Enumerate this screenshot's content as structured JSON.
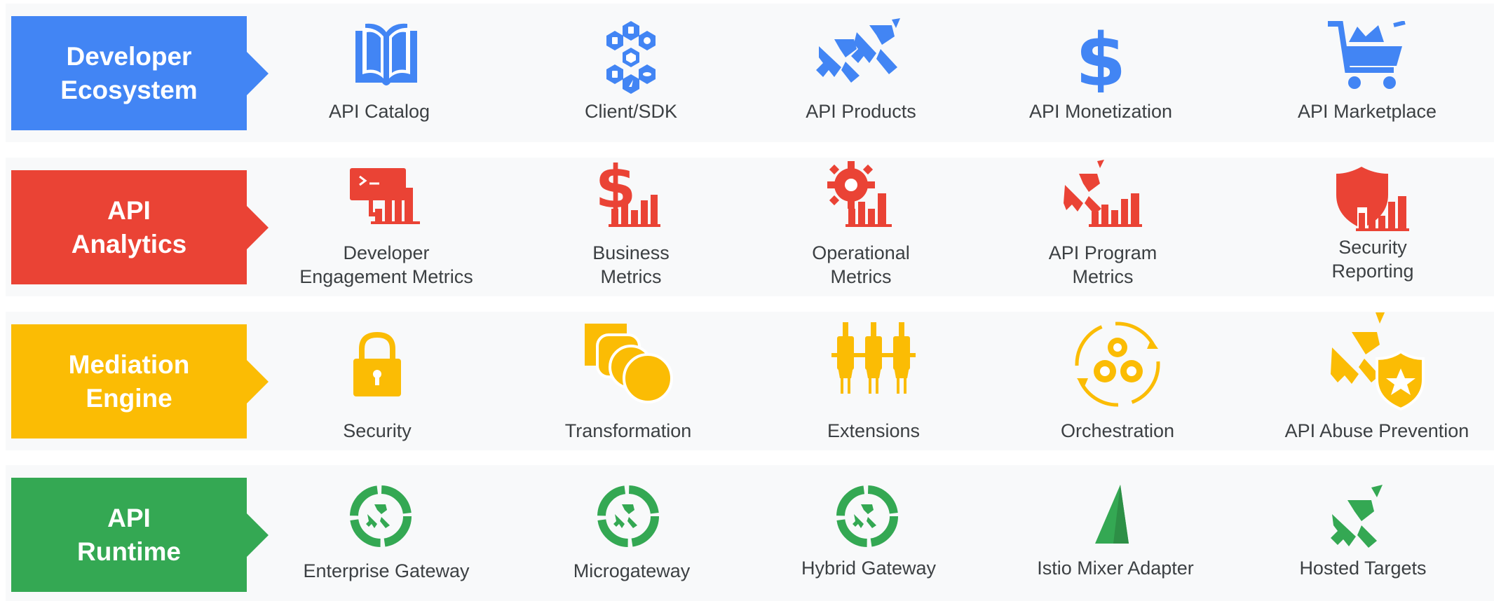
{
  "colors": {
    "blue": "#4285f4",
    "red": "#ea4335",
    "yellow": "#fbbc04",
    "green": "#34a853",
    "text": "#3c4043",
    "row_bg": "#f8f9fa"
  },
  "rows": [
    {
      "label": [
        "Developer",
        "Ecosystem"
      ],
      "items": [
        {
          "caption": [
            "API Catalog"
          ],
          "icon": "open-book-icon"
        },
        {
          "caption": [
            "Client/SDK"
          ],
          "icon": "hexagon-languages-icon"
        },
        {
          "caption": [
            "API Products"
          ],
          "icon": "api-logo-pair-icon"
        },
        {
          "caption": [
            "API Monetization"
          ],
          "icon": "dollar-icon"
        },
        {
          "caption": [
            "API Marketplace"
          ],
          "icon": "shopping-cart-icon"
        }
      ]
    },
    {
      "label": [
        "API",
        "Analytics"
      ],
      "items": [
        {
          "caption": [
            "Developer",
            "Engagement Metrics"
          ],
          "icon": "terminal-chart-icon"
        },
        {
          "caption": [
            "Business",
            "Metrics"
          ],
          "icon": "dollar-chart-icon"
        },
        {
          "caption": [
            "Operational",
            "Metrics"
          ],
          "icon": "gear-chart-icon"
        },
        {
          "caption": [
            "API Program",
            "Metrics"
          ],
          "icon": "api-chart-icon"
        },
        {
          "caption": [
            "Security",
            "Reporting"
          ],
          "icon": "shield-chart-icon"
        }
      ]
    },
    {
      "label": [
        "Mediation",
        "Engine"
      ],
      "items": [
        {
          "caption": [
            "Security"
          ],
          "icon": "padlock-icon"
        },
        {
          "caption": [
            "Transformation"
          ],
          "icon": "shapes-transform-icon"
        },
        {
          "caption": [
            "Extensions"
          ],
          "icon": "plugs-icon"
        },
        {
          "caption": [
            "Orchestration"
          ],
          "icon": "gears-cycle-icon"
        },
        {
          "caption": [
            "API Abuse Prevention"
          ],
          "icon": "api-shield-star-icon"
        }
      ]
    },
    {
      "label": [
        "API",
        "Runtime"
      ],
      "items": [
        {
          "caption": [
            "Enterprise Gateway"
          ],
          "icon": "gateway-ring-icon"
        },
        {
          "caption": [
            "Microgateway"
          ],
          "icon": "gateway-ring-icon"
        },
        {
          "caption": [
            "Hybrid Gateway"
          ],
          "icon": "gateway-ring-icon"
        },
        {
          "caption": [
            "Istio Mixer Adapter"
          ],
          "icon": "istio-sail-icon"
        },
        {
          "caption": [
            "Hosted Targets"
          ],
          "icon": "api-logo-icon"
        }
      ]
    }
  ]
}
